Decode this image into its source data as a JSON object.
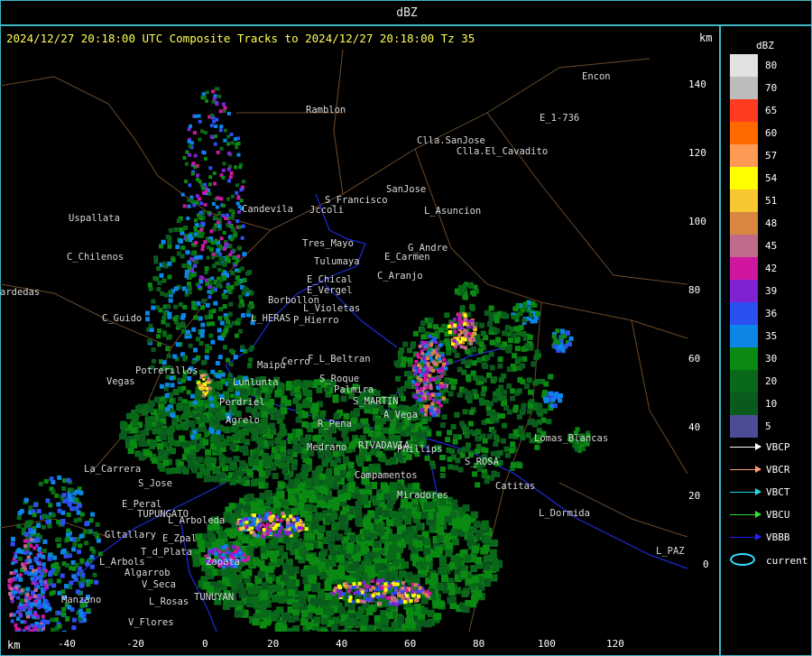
{
  "window": {
    "title": "dBZ"
  },
  "header": {
    "text": "2024/12/27 20:18:00 UTC Composite Tracks to 2024/12/27 20:18:00 Tz 35",
    "km_label": "km"
  },
  "axes": {
    "x_label": "km",
    "x_ticks": [
      "-40",
      "-20",
      "0",
      "20",
      "40",
      "60",
      "80",
      "100",
      "120"
    ],
    "y_ticks": [
      "140",
      "120",
      "100",
      "80",
      "60",
      "40",
      "20",
      "0"
    ]
  },
  "legend": {
    "title": "dBZ",
    "scale": [
      {
        "label": "80",
        "color": "#e2e2e2"
      },
      {
        "label": "70",
        "color": "#bcbcbc"
      },
      {
        "label": "65",
        "color": "#ff3b22"
      },
      {
        "label": "60",
        "color": "#ff6a00"
      },
      {
        "label": "57",
        "color": "#ff9a55"
      },
      {
        "label": "54",
        "color": "#ffff00"
      },
      {
        "label": "51",
        "color": "#f7c630"
      },
      {
        "label": "48",
        "color": "#d7873f"
      },
      {
        "label": "45",
        "color": "#c06a8c"
      },
      {
        "label": "42",
        "color": "#d016a0"
      },
      {
        "label": "39",
        "color": "#7f22d4"
      },
      {
        "label": "36",
        "color": "#2c4ff2"
      },
      {
        "label": "35",
        "color": "#0b86e6"
      },
      {
        "label": "30",
        "color": "#0a8a12"
      },
      {
        "label": "20",
        "color": "#086a18"
      },
      {
        "label": "10",
        "color": "#0a5a1e"
      },
      {
        "label": "5",
        "color": "#4b4b96"
      }
    ],
    "tracks": [
      {
        "label": "VBCP",
        "color": "#ffffff"
      },
      {
        "label": "VBCR",
        "color": "#ff9a7a"
      },
      {
        "label": "VBCT",
        "color": "#22dddd"
      },
      {
        "label": "VBCU",
        "color": "#33dd33"
      },
      {
        "label": "VBBB",
        "color": "#2222ff"
      }
    ],
    "current_label": "current",
    "current_color": "#33ddff"
  },
  "places": [
    {
      "name": "Ramblon"
    },
    {
      "name": "Clla.SanJose"
    },
    {
      "name": "Clla.El_Cavadito"
    },
    {
      "name": "E_1-736"
    },
    {
      "name": "Encon"
    },
    {
      "name": "SanJose"
    },
    {
      "name": "S_Francisco"
    },
    {
      "name": "Jccoli"
    },
    {
      "name": "L_Asuncion"
    },
    {
      "name": "Uspallata"
    },
    {
      "name": "Candevila"
    },
    {
      "name": "C_Chilenos"
    },
    {
      "name": "Tres_Mayo"
    },
    {
      "name": "Tulumaya"
    },
    {
      "name": "G_Andre"
    },
    {
      "name": "E_Carmen"
    },
    {
      "name": "E_Chical"
    },
    {
      "name": "E_Vergel"
    },
    {
      "name": "C_Aranjo"
    },
    {
      "name": "Borbollon"
    },
    {
      "name": "C_Guido"
    },
    {
      "name": "L_Violetas"
    },
    {
      "name": "P_Hierro"
    },
    {
      "name": "L_HERAS"
    },
    {
      "name": "Potrerillos"
    },
    {
      "name": "Vegas"
    },
    {
      "name": "F_L_Beltran"
    },
    {
      "name": "S_Roque"
    },
    {
      "name": "Palmira"
    },
    {
      "name": "S_MARTIN"
    },
    {
      "name": "Perdriel"
    },
    {
      "name": "Agrelo"
    },
    {
      "name": "R_Pena"
    },
    {
      "name": "A_Vega"
    },
    {
      "name": "Lomas_Blancas"
    },
    {
      "name": "RIVADAVIA"
    },
    {
      "name": "Phillips"
    },
    {
      "name": "La_Carrera"
    },
    {
      "name": "S_Jose"
    },
    {
      "name": "E_Peral"
    },
    {
      "name": "TUPUNGATO"
    },
    {
      "name": "L_Arboleda"
    },
    {
      "name": "Gltallary"
    },
    {
      "name": "E_Zpal"
    },
    {
      "name": "T_d_Plata"
    },
    {
      "name": "L_Arbols"
    },
    {
      "name": "Algarrob"
    },
    {
      "name": "Zapata"
    },
    {
      "name": "V_Seca"
    },
    {
      "name": "TUNUYAN"
    },
    {
      "name": "L_Rosas"
    },
    {
      "name": "Manzano"
    },
    {
      "name": "V_Flores"
    },
    {
      "name": "S_ROSA"
    },
    {
      "name": "Catitas"
    },
    {
      "name": "L_Dormida"
    },
    {
      "name": "L_PAZ"
    },
    {
      "name": "Miradores"
    },
    {
      "name": "Campamentos"
    },
    {
      "name": "ardedas"
    },
    {
      "name": "Medrano"
    },
    {
      "name": "Cerro"
    },
    {
      "name": "Maipu"
    },
    {
      "name": "Lunlunta"
    }
  ]
}
